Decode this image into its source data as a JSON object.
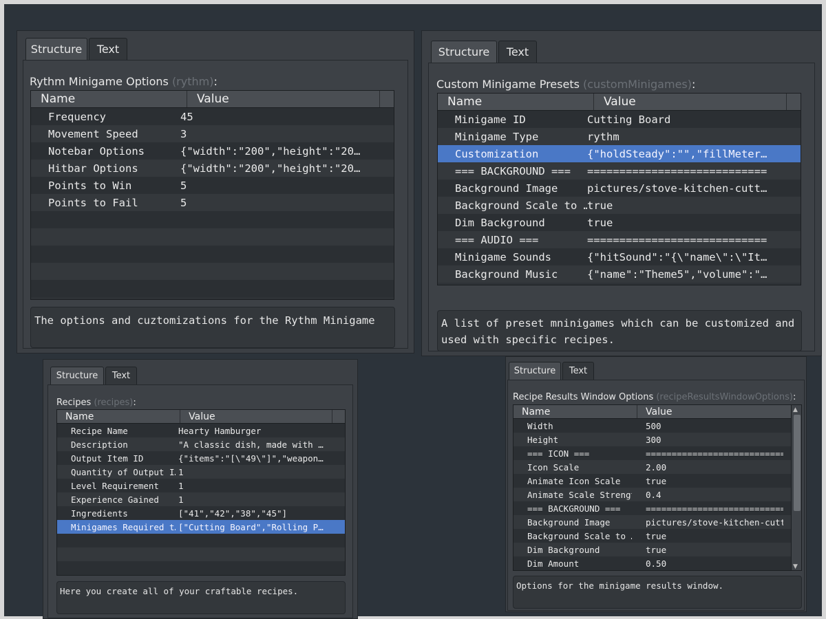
{
  "tabs": {
    "structure": "Structure",
    "text": "Text"
  },
  "rythm": {
    "title": "Rythm Minigame Options",
    "key": "(rythm)",
    "colon": ":",
    "col_name": "Name",
    "col_value": "Value",
    "rows": [
      {
        "name": "Frequency",
        "value": "45"
      },
      {
        "name": "Movement Speed",
        "value": "3"
      },
      {
        "name": "Notebar Options",
        "value": "{\"width\":\"200\",\"height\":\"20…"
      },
      {
        "name": "Hitbar Options",
        "value": "{\"width\":\"200\",\"height\":\"20…"
      },
      {
        "name": "Points to Win",
        "value": "5"
      },
      {
        "name": "Points to Fail",
        "value": "5"
      }
    ],
    "description": "The options and cuztomizations for the Rythm Minigame"
  },
  "custom": {
    "title": "Custom Minigame Presets",
    "key": "(customMinigames)",
    "colon": ":",
    "col_name": "Name",
    "col_value": "Value",
    "rows": [
      {
        "name": "Minigame ID",
        "value": "Cutting Board"
      },
      {
        "name": "Minigame Type",
        "value": "rythm"
      },
      {
        "name": "Customization",
        "value": "{\"holdSteady\":\"\",\"fillMeter…"
      },
      {
        "name": "=== BACKGROUND ===",
        "value": "============================"
      },
      {
        "name": "Background Image",
        "value": "pictures/stove-kitchen-cutt…"
      },
      {
        "name": "Background Scale to …",
        "value": "true"
      },
      {
        "name": "Dim Background",
        "value": "true"
      },
      {
        "name": "=== AUDIO ===",
        "value": "============================"
      },
      {
        "name": "Minigame Sounds",
        "value": "{\"hitSound\":\"{\\\"name\\\":\\\"It…"
      },
      {
        "name": "Background Music",
        "value": "{\"name\":\"Theme5\",\"volume\":\"…"
      }
    ],
    "description": "A list of preset mninigames which can be customized and used with specific recipes."
  },
  "recipes": {
    "title": "Recipes",
    "key": "(recipes)",
    "colon": ":",
    "col_name": "Name",
    "col_value": "Value",
    "rows": [
      {
        "name": "Recipe Name",
        "value": "Hearty Hamburger"
      },
      {
        "name": "Description",
        "value": "\"A classic dish, made with …"
      },
      {
        "name": "Output Item ID",
        "value": "{\"items\":\"[\\\"49\\\"]\",\"weapon…"
      },
      {
        "name": "Quantity of Output I…",
        "value": "1"
      },
      {
        "name": "Level Requirement",
        "value": "1"
      },
      {
        "name": "Experience Gained",
        "value": "1"
      },
      {
        "name": "Ingredients",
        "value": "[\"41\",\"42\",\"38\",\"45\"]"
      },
      {
        "name": "Minigames Required t…",
        "value": "[\"Cutting Board\",\"Rolling P…"
      }
    ],
    "description": "Here you create all of your craftable recipes."
  },
  "results": {
    "title": "Recipe Results Window Options",
    "key": "(recipeResultsWindowOptions)",
    "colon": ":",
    "col_name": "Name",
    "col_value": "Value",
    "rows": [
      {
        "name": "Width",
        "value": "500"
      },
      {
        "name": "Height",
        "value": "300"
      },
      {
        "name": "=== ICON ===",
        "value": "==========================="
      },
      {
        "name": "Icon Scale",
        "value": "2.00"
      },
      {
        "name": "Animate Icon Scale",
        "value": "true"
      },
      {
        "name": "Animate Scale Strength",
        "value": "0.4"
      },
      {
        "name": "=== BACKGROUND ===",
        "value": "==========================="
      },
      {
        "name": "Background Image",
        "value": "pictures/stove-kitchen-cutt…"
      },
      {
        "name": "Background Scale to …",
        "value": "true"
      },
      {
        "name": "Dim Background",
        "value": "true"
      },
      {
        "name": "Dim Amount",
        "value": "0.50"
      }
    ],
    "description": "Options for the minigame results window."
  }
}
